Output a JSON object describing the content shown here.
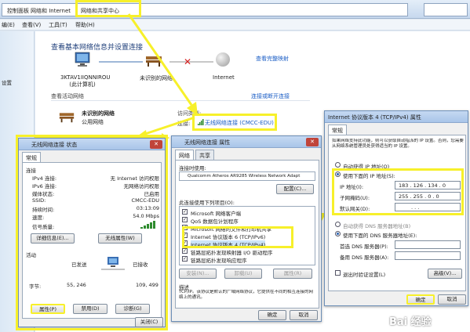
{
  "explorer": {
    "breadcrumbs": [
      "控制面板",
      "网络和 Internet",
      "网络和共享中心"
    ],
    "menu": [
      "编(E)",
      "查看(V)",
      "工具(T)",
      "帮助(H)"
    ],
    "left_pane": [
      "",
      "",
      "设置"
    ],
    "main_title": "查看基本网络信息并设置连接",
    "full_map_link": "查看完整映射",
    "pc_name": "3KTAV1IIQNNIROU",
    "pc_sub": "(此计算机)",
    "unidentified_network": "未识别的网络",
    "internet": "Internet",
    "active_networks_title": "查看活动网络",
    "connect_disconnect_link": "连接或断开连接",
    "network_name": "未识别的网络",
    "network_type": "公用网络",
    "access_type_label": "访问类型:",
    "connections_label": "连接:",
    "wifi_link": "无线网络连接 (CMCC-EDU)"
  },
  "status_dialog": {
    "title": "无线网络连接 状态",
    "tab": "常规",
    "section_connect": "连接",
    "rows": [
      {
        "label": "IPv4 连接:",
        "value": "无 Internet 访问权限"
      },
      {
        "label": "IPv6 连接:",
        "value": "无网络访问权限"
      },
      {
        "label": "媒体状态:",
        "value": "已启用"
      },
      {
        "label": "SSID:",
        "value": "CMCC-EDU"
      },
      {
        "label": "持续时间:",
        "value": "03:13:09"
      },
      {
        "label": "速度:",
        "value": "54.0 Mbps"
      }
    ],
    "signal_label": "信号质量:",
    "details_btn": "详细信息(E)...",
    "wireless_props_btn": "无线属性(W)",
    "section_activity": "活动",
    "sent_label": "已发送",
    "received_label": "已接收",
    "bytes_label": "字节:",
    "bytes_sent": "55, 246",
    "bytes_received": "109, 499",
    "properties_btn": "属性(P)",
    "disable_btn": "禁用(D)",
    "diagnose_btn": "诊断(G)",
    "close_btn": "关闭(C)"
  },
  "props_dialog": {
    "title": "无线网络连接 属性",
    "tabs": [
      "网络",
      "共享"
    ],
    "connect_using_label": "连接时使用:",
    "adapter": "Qualcomm Atheros AR9285 Wireless Network Adapt",
    "configure_btn": "配置(C)...",
    "items_label": "此连接使用下列项目(O):",
    "items": [
      "Microsoft 网络客户端",
      "QoS 数据包计划程序",
      "Microsoft 网络的文件和打印机共享",
      "Internet 协议版本 6 (TCP/IPv6)",
      "Internet 协议版本 4 (TCP/IPv4)",
      "链路层拓扑发现映射器 I/O 驱动程序",
      "链路层拓扑发现响应程序"
    ],
    "install_btn": "安装(N)...",
    "uninstall_btn": "卸载(U)",
    "properties_btn": "属性(R)",
    "description_label": "描述",
    "description": "TCP/IP。该协议是默认的广域网络协议，它提供在不同的相互连接的网络上的通讯。",
    "ok_btn": "确定",
    "cancel_btn": "取消"
  },
  "ipv4_dialog": {
    "title": "Internet 协议版本 4 (TCP/IPv4) 属性",
    "tab": "常规",
    "intro": "如果网络支持此功能，则可以获取自动指派的 IP 设置。否则，您需要从网络系统管理员处获得适当的 IP 设置。",
    "auto_ip": "自动获得 IP 地址(O)",
    "manual_ip": "使用下面的 IP 地址(S):",
    "ip_label": "IP 地址(I):",
    "ip_value": "183 . 126 . 134 . 0",
    "mask_label": "子网掩码(U):",
    "mask_value": "255 . 255 . 0 . 0",
    "gateway_label": "默认网关(D):",
    "gateway_value": ". . .",
    "auto_dns": "自动获得 DNS 服务器地址(B)",
    "manual_dns": "使用下面的 DNS 服务器地址(E):",
    "pref_dns_label": "首选 DNS 服务器(P):",
    "alt_dns_label": "备用 DNS 服务器(A):",
    "validate_label": "退出时验证设置(L)",
    "advanced_btn": "高级(V)...",
    "ok_btn": "确定",
    "cancel_btn": "取消"
  },
  "watermark": "Bai 经验",
  "colors": {
    "highlight": "#f7f02a",
    "link": "#1a5dc5",
    "title_bar": "#a9c5e9"
  }
}
